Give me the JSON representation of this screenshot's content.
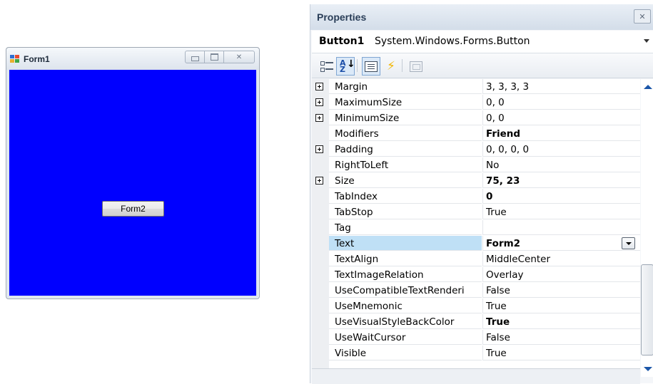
{
  "form_window": {
    "title": "Form1",
    "client_color": "#0000ff",
    "button_label": "Form2"
  },
  "properties": {
    "title": "Properties",
    "object_name": "Button1",
    "object_type": "System.Windows.Forms.Button",
    "toolbar_icons": [
      "categorized-icon",
      "alphabetical-sort-icon",
      "properties-icon",
      "events-lightning-icon",
      "property-pages-icon"
    ],
    "rows": [
      {
        "name": "Margin",
        "value": "3, 3, 3, 3",
        "expandable": true,
        "bold": false
      },
      {
        "name": "MaximumSize",
        "value": "0, 0",
        "expandable": true,
        "bold": false
      },
      {
        "name": "MinimumSize",
        "value": "0, 0",
        "expandable": true,
        "bold": false
      },
      {
        "name": "Modifiers",
        "value": "Friend",
        "expandable": false,
        "bold": true
      },
      {
        "name": "Padding",
        "value": "0, 0, 0, 0",
        "expandable": true,
        "bold": false
      },
      {
        "name": "RightToLeft",
        "value": "No",
        "expandable": false,
        "bold": false
      },
      {
        "name": "Size",
        "value": "75, 23",
        "expandable": true,
        "bold": true
      },
      {
        "name": "TabIndex",
        "value": "0",
        "expandable": false,
        "bold": true
      },
      {
        "name": "TabStop",
        "value": "True",
        "expandable": false,
        "bold": false
      },
      {
        "name": "Tag",
        "value": "",
        "expandable": false,
        "bold": false
      },
      {
        "name": "Text",
        "value": "Form2",
        "expandable": false,
        "bold": true,
        "selected": true
      },
      {
        "name": "TextAlign",
        "value": "MiddleCenter",
        "expandable": false,
        "bold": false
      },
      {
        "name": "TextImageRelation",
        "value": "Overlay",
        "expandable": false,
        "bold": false
      },
      {
        "name": "UseCompatibleTextRenderi",
        "value": "False",
        "expandable": false,
        "bold": false
      },
      {
        "name": "UseMnemonic",
        "value": "True",
        "expandable": false,
        "bold": false
      },
      {
        "name": "UseVisualStyleBackColor",
        "value": "True",
        "expandable": false,
        "bold": true
      },
      {
        "name": "UseWaitCursor",
        "value": "False",
        "expandable": false,
        "bold": false
      },
      {
        "name": "Visible",
        "value": "True",
        "expandable": false,
        "bold": false
      }
    ],
    "selection_color": "#bfe0f6"
  }
}
